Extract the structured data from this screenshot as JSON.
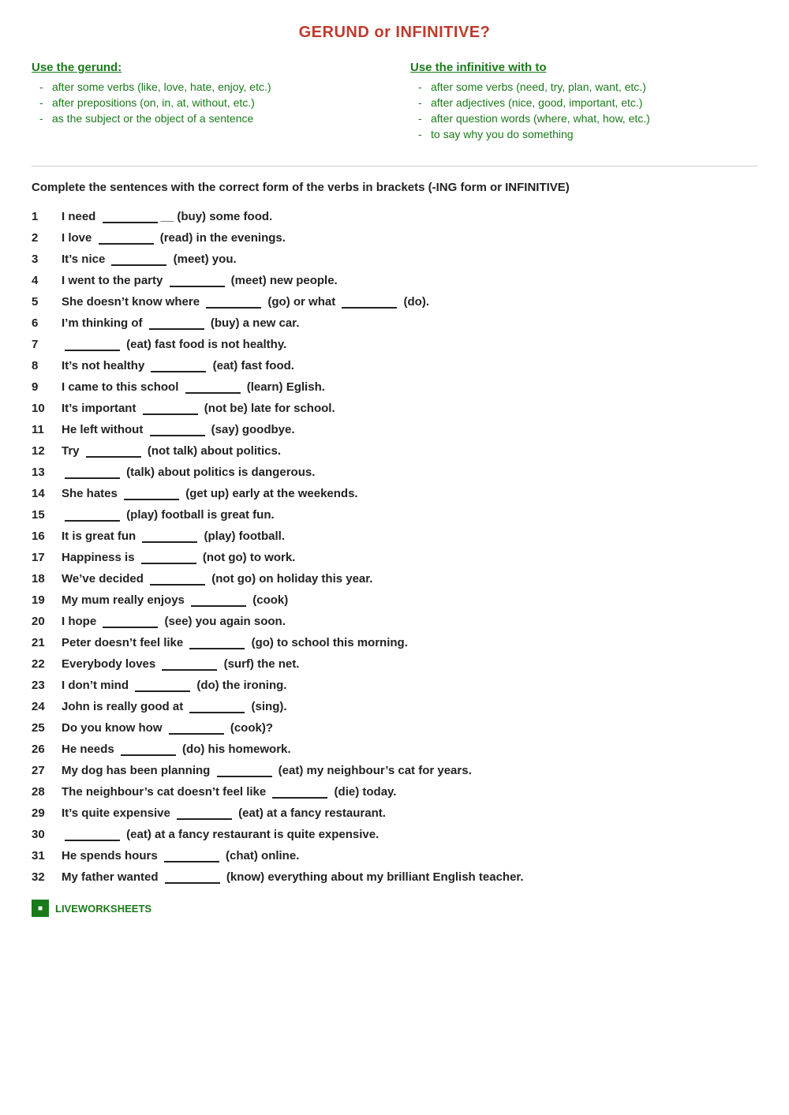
{
  "title": "GERUND or INFINITIVE?",
  "gerund": {
    "heading": "Use the gerund:",
    "items": [
      "after some verbs (like, love, hate, enjoy,  etc.)",
      "after prepositions (on, in, at, without, etc.)",
      "as the subject or the object of a sentence"
    ]
  },
  "infinitive": {
    "heading": "Use the infinitive with to",
    "items": [
      "after some verbs (need, try, plan, want, etc.)",
      "after adjectives (nice, good, important, etc.)",
      "after question words (where, what, how, etc.)",
      "to say why you do something"
    ]
  },
  "instructions": "Complete the sentences with the correct form of the verbs in brackets (-ING form or INFINITIVE)",
  "sentences": [
    {
      "num": "1",
      "text": "I need __________ (buy) some food."
    },
    {
      "num": "2",
      "text": "I love ________ (read) in the evenings."
    },
    {
      "num": "3",
      "text": "It’s nice ________ (meet) you."
    },
    {
      "num": "4",
      "text": "I went to the party ________ (meet) new people."
    },
    {
      "num": "5",
      "text": "She doesn’t know where ________ (go) or what ________ (do)."
    },
    {
      "num": "6",
      "text": "I’m thinking of ________ (buy) a new car."
    },
    {
      "num": "7",
      "text": "________ (eat) fast food is not healthy."
    },
    {
      "num": "8",
      "text": "It’s not healthy ________ (eat) fast food."
    },
    {
      "num": "9",
      "text": "I came to this school ________ (learn) Eglish."
    },
    {
      "num": "10",
      "text": "It’s important ________ (not be) late for school."
    },
    {
      "num": "11",
      "text": "He left without ________ (say) goodbye."
    },
    {
      "num": "12",
      "text": "Try ________ (not talk) about politics."
    },
    {
      "num": "13",
      "text": "________ (talk) about politics is dangerous."
    },
    {
      "num": "14",
      "text": "She hates ________ (get up) early at the weekends."
    },
    {
      "num": "15",
      "text": "________ (play) football is great fun."
    },
    {
      "num": "16",
      "text": "It is great fun ________ (play) football."
    },
    {
      "num": "17",
      "text": "Happiness is ________ (not go) to work."
    },
    {
      "num": "18",
      "text": "We’ve decided ________ (not go) on holiday this year."
    },
    {
      "num": "19",
      "text": "My mum really enjoys ________ (cook)"
    },
    {
      "num": "20",
      "text": "I hope ________ (see) you again soon."
    },
    {
      "num": "21",
      "text": "Peter doesn’t feel like ________ (go) to school this morning."
    },
    {
      "num": "22",
      "text": "Everybody loves ________ (surf) the net."
    },
    {
      "num": "23",
      "text": "I don’t mind ________ (do) the ironing."
    },
    {
      "num": "24",
      "text": "John is really good at ________ (sing)."
    },
    {
      "num": "25",
      "text": "Do you know how ________ (cook)?"
    },
    {
      "num": "26",
      "text": "He needs ________ (do) his homework."
    },
    {
      "num": "27",
      "text": "My dog has been planning ________ (eat) my neighbour’s cat for years."
    },
    {
      "num": "28",
      "text": "The neighbour’s cat doesn’t feel like ________ (die) today."
    },
    {
      "num": "29",
      "text": "It’s quite expensive ________ (eat) at a fancy restaurant."
    },
    {
      "num": "30",
      "text": "________ (eat) at a fancy restaurant is quite expensive."
    },
    {
      "num": "31",
      "text": "He spends hours ________ (chat) online."
    },
    {
      "num": "32",
      "text": "My father wanted ________ (know) everything about my brilliant English teacher."
    }
  ],
  "footer": {
    "logo_text": "LIVEWORKSHEETS"
  }
}
